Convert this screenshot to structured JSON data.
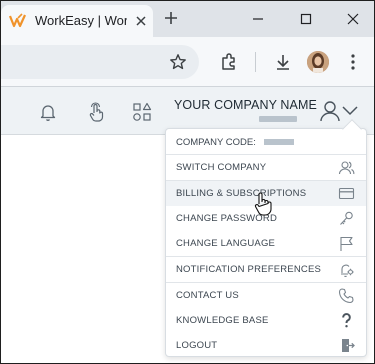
{
  "browser": {
    "tab_title": "WorkEasy | Wor",
    "tab_close_icon": "close-icon",
    "new_tab_icon": "plus-icon"
  },
  "toolbar": {
    "icons": [
      "star-icon",
      "extensions-icon",
      "download-icon",
      "profile-avatar",
      "more-icon"
    ]
  },
  "header": {
    "company_name": "YOUR COMPANY NAME",
    "icons": [
      "bell-icon",
      "touch-icon",
      "shapes-icon",
      "user-icon",
      "chevron-down-icon"
    ]
  },
  "menu": {
    "company_code_label": "COMPANY CODE:",
    "items": [
      {
        "label": "SWITCH COMPANY",
        "icon": "users-icon"
      },
      {
        "label": "BILLING & SUBSCRIPTIONS",
        "icon": "credit-card-icon"
      },
      {
        "label": "CHANGE PASSWORD",
        "icon": "key-icon"
      },
      {
        "label": "CHANGE LANGUAGE",
        "icon": "flag-icon"
      },
      {
        "label": "NOTIFICATION PREFERENCES",
        "icon": "bell-gear-icon"
      },
      {
        "label": "CONTACT US",
        "icon": "phone-icon"
      },
      {
        "label": "KNOWLEDGE BASE",
        "icon": "question-icon"
      },
      {
        "label": "LOGOUT",
        "icon": "logout-icon"
      }
    ],
    "hovered_item": "BILLING & SUBSCRIPTIONS"
  },
  "colors": {
    "accent": "#f0932b",
    "text": "#3c4650",
    "header_bg": "#eef2f5"
  }
}
